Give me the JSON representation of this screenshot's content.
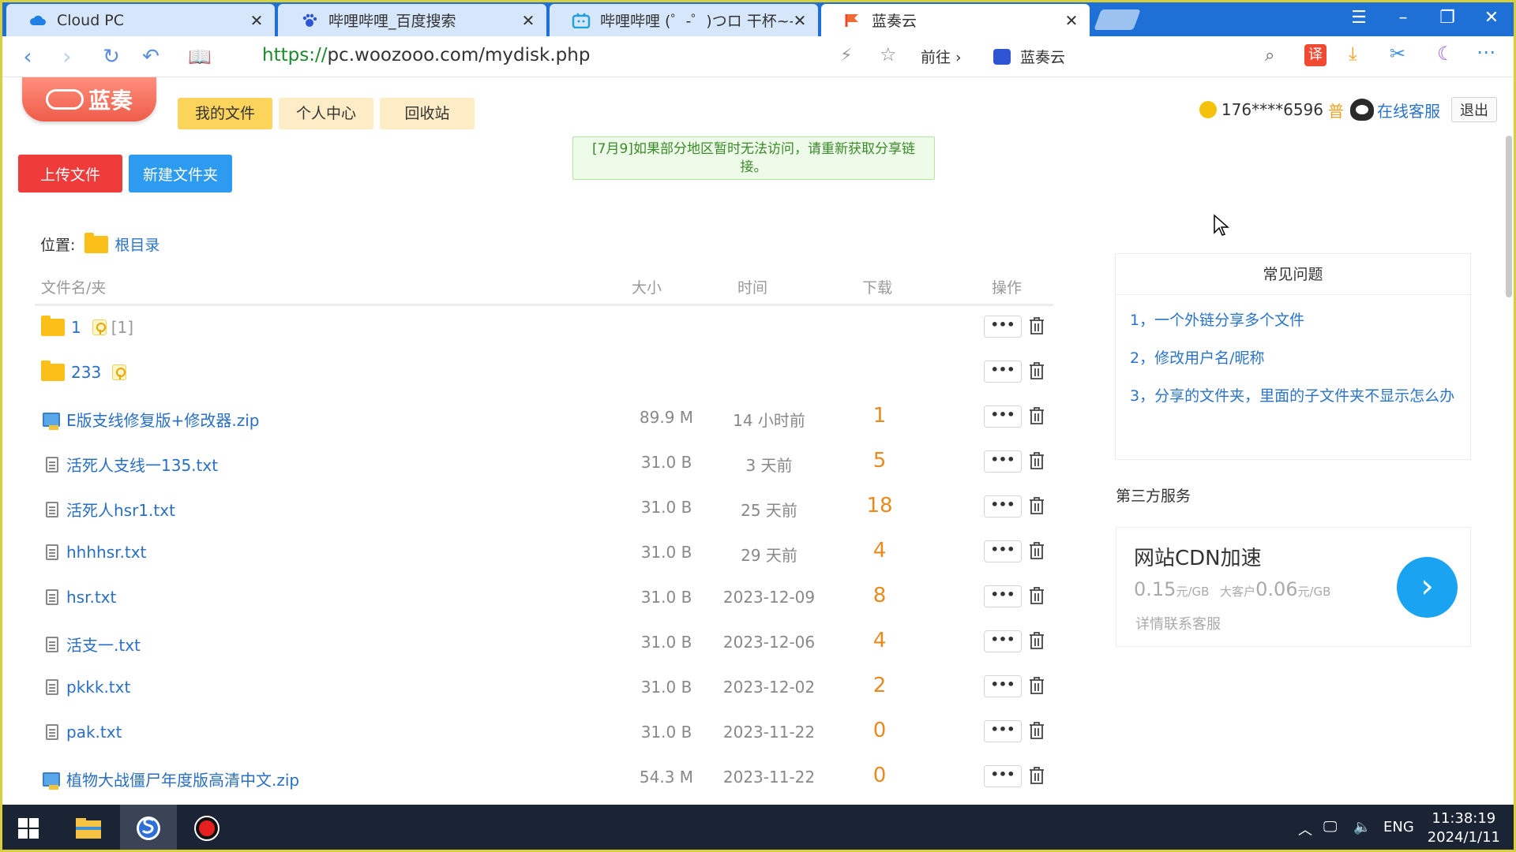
{
  "browser": {
    "tabs": [
      {
        "title": "Cloud PC",
        "icon": "cloud-icon"
      },
      {
        "title": "哔哩哔哩_百度搜索",
        "icon": "baidu-paw-icon"
      },
      {
        "title": "哔哩哔哩 (゜-゜)つロ 干杯~-bi",
        "icon": "bilibili-icon"
      },
      {
        "title": "蓝奏云",
        "icon": "lanzou-flag-icon"
      }
    ],
    "url_protocol": "https://",
    "url_rest": "pc.woozooo.com/mydisk.php",
    "go_label": "前往",
    "search_engine_label": "蓝奏云",
    "translate_label": "译"
  },
  "site": {
    "logo_text": "蓝奏",
    "nav": [
      "我的文件",
      "个人中心",
      "回收站"
    ],
    "user": "176****6596",
    "tier": "普",
    "service": "在线客服",
    "logout": "退出"
  },
  "actions": {
    "upload": "上传文件",
    "new_folder": "新建文件夹"
  },
  "notice": "[7月9]如果部分地区暂时无法访问，请重新获取分享链接。",
  "location": {
    "label": "位置:",
    "root": "根目录"
  },
  "table": {
    "headers": {
      "name": "文件名/夹",
      "size": "大小",
      "time": "时间",
      "downloads": "下载",
      "ops": "操作"
    },
    "more_label": "•••",
    "rows": [
      {
        "type": "folder",
        "name": "1",
        "locked": true,
        "count": "[1]",
        "size": "",
        "time": "",
        "downloads": ""
      },
      {
        "type": "folder",
        "name": "233",
        "locked": true,
        "count": "",
        "size": "",
        "time": "",
        "downloads": ""
      },
      {
        "type": "zip",
        "name": "E版支线修复版+修改器.zip",
        "size": "89.9 M",
        "time": "14 小时前",
        "downloads": "1"
      },
      {
        "type": "txt",
        "name": "活死人支线一135.txt",
        "size": "31.0 B",
        "time": "3 天前",
        "downloads": "5"
      },
      {
        "type": "txt",
        "name": "活死人hsr1.txt",
        "size": "31.0 B",
        "time": "25 天前",
        "downloads": "18"
      },
      {
        "type": "txt",
        "name": "hhhhsr.txt",
        "size": "31.0 B",
        "time": "29 天前",
        "downloads": "4"
      },
      {
        "type": "txt",
        "name": "hsr.txt",
        "size": "31.0 B",
        "time": "2023-12-09",
        "downloads": "8"
      },
      {
        "type": "txt",
        "name": "活支一.txt",
        "size": "31.0 B",
        "time": "2023-12-06",
        "downloads": "4"
      },
      {
        "type": "txt",
        "name": "pkkk.txt",
        "size": "31.0 B",
        "time": "2023-12-02",
        "downloads": "2"
      },
      {
        "type": "txt",
        "name": "pak.txt",
        "size": "31.0 B",
        "time": "2023-11-22",
        "downloads": "0"
      },
      {
        "type": "zip",
        "name": "植物大战僵尸年度版高清中文.zip",
        "size": "54.3 M",
        "time": "2023-11-22",
        "downloads": "0"
      }
    ]
  },
  "faq": {
    "title": "常见问题",
    "items": [
      "1，一个外链分享多个文件",
      "2，修改用户名/昵称",
      "3，分享的文件夹，里面的子文件夹不显示怎么办"
    ]
  },
  "third_party": {
    "title": "第三方服务",
    "cdn_title": "网站CDN加速",
    "price1": "0.15",
    "unit1": "元/GB",
    "mid_label": "大客户",
    "price2": "0.06",
    "unit2": "元/GB",
    "note": "详情联系客服"
  },
  "taskbar": {
    "language": "ENG",
    "time": "11:38:19",
    "date": "2024/1/11"
  },
  "colors": {
    "tabbar": "#1e6fd6",
    "upload": "#f03b3b",
    "new_folder": "#2d9bef",
    "download_count": "#e88a1f",
    "link": "#2a73c9"
  }
}
